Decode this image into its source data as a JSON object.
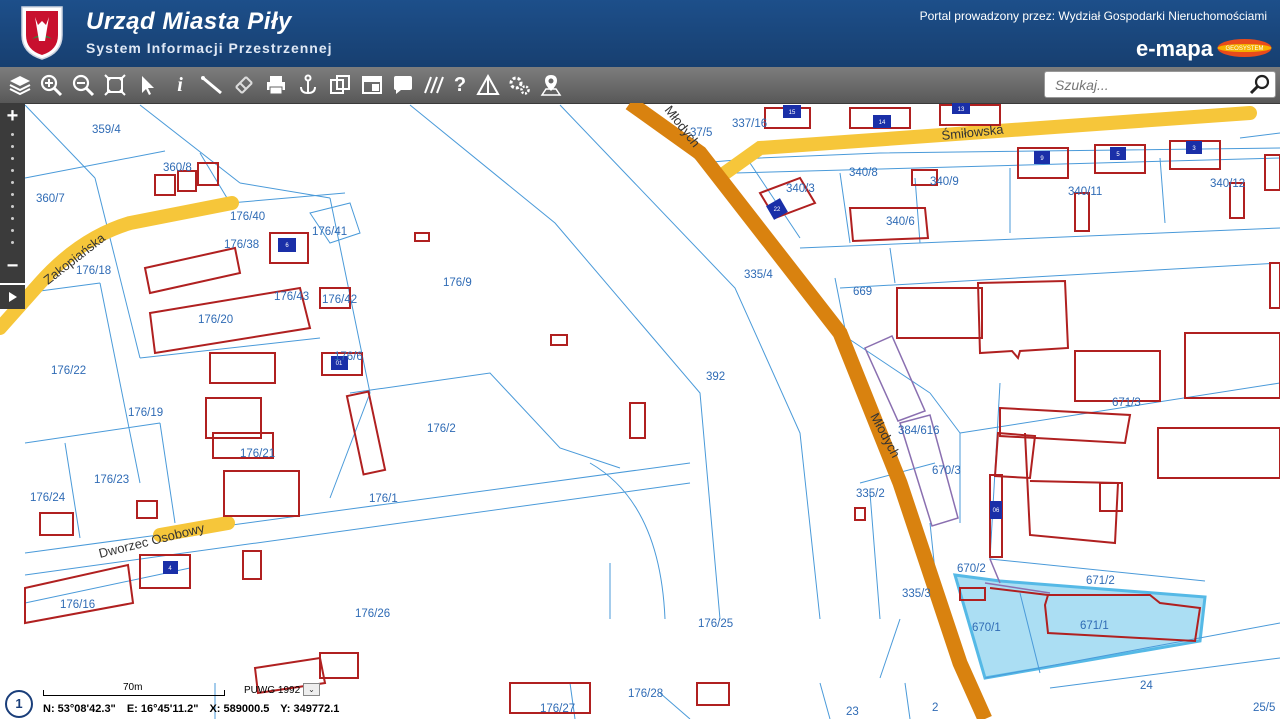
{
  "header": {
    "title": "Urząd Miasta Piły",
    "subtitle": "System Informacji Przestrzennej",
    "portal_text": "Portal prowadzony przez: Wydział Gospodarki Nieruchomościami",
    "brand": "e-mapa",
    "brand_logo_text": "GEOSYSTEM"
  },
  "toolbar": {
    "tools": [
      "layers-icon",
      "zoom-in-icon",
      "zoom-out-icon",
      "zoom-extent-icon",
      "select-arrow-icon",
      "info-icon",
      "measure-icon",
      "link-icon",
      "print-icon",
      "anchor-icon",
      "copy-icon",
      "layout-icon",
      "comment-icon",
      "hatch-icon",
      "help-icon",
      "triangle-icon",
      "settings-icon",
      "location-icon"
    ],
    "search_placeholder": "Szukaj..."
  },
  "zoom": {
    "plus": "+",
    "minus": "−"
  },
  "map": {
    "parcel_labels": [
      "359/4",
      "360/8",
      "360/7",
      "176/40",
      "176/38",
      "176/41",
      "176/18",
      "176/43",
      "176/42",
      "176/9",
      "176/20",
      "176/22",
      "176/6",
      "176/19",
      "176/2",
      "176/24",
      "176/23",
      "176/21",
      "176/1",
      "176/16",
      "176/26",
      "176/25",
      "176/28",
      "176/27",
      "392",
      "335/4",
      "335/2",
      "335/3",
      "337/16",
      "340/3",
      "340/8",
      "340/9",
      "340/6",
      "340/11",
      "340/12",
      "669",
      "384/616",
      "670/3",
      "670/2",
      "670/1",
      "671/3",
      "671/2",
      "671/1",
      "24",
      "23",
      "2",
      "25/5",
      "37/5"
    ],
    "streets": [
      "Zakopiańska",
      "Śmiłowska",
      "Młodych",
      "Młodych",
      "Dworzec Osobowy"
    ],
    "building_numbers": [
      "15",
      "13",
      "14",
      "9",
      "5",
      "3",
      "22",
      "6",
      "01",
      "4",
      "06"
    ],
    "colors": {
      "parcel_line": "#4a9ad9",
      "building": "#b02020",
      "road_yellow": "#f6c63a",
      "road_orange": "#d9820f",
      "highlight": "#8fd3ef",
      "number_box": "#1a2fa8"
    }
  },
  "footer": {
    "help_label": "1",
    "scale_label": "70m",
    "crs": "PUWG 1992",
    "dropdown": "⌄",
    "coords": {
      "n": "N: 53°08'42.3\"",
      "e": "E: 16°45'11.2\"",
      "x": "X: 589000.5",
      "y": "Y: 349772.1"
    }
  }
}
